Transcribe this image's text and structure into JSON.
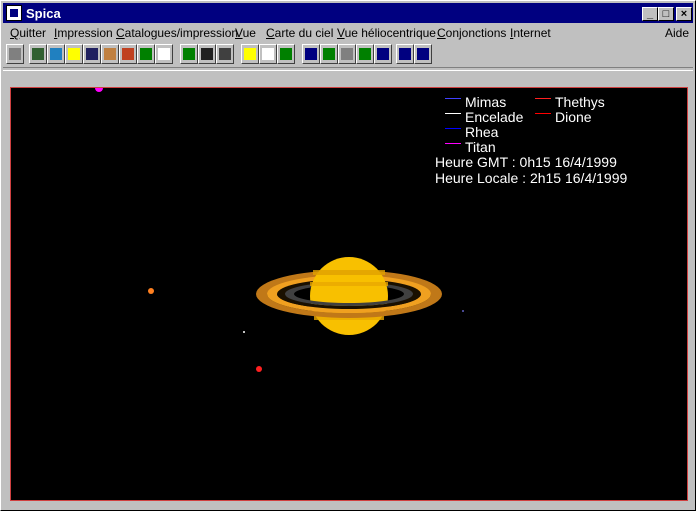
{
  "window": {
    "title": "Spica"
  },
  "menu": [
    {
      "label": "Quitter",
      "u": "Q",
      "rest": "uitter"
    },
    {
      "label": "Impression",
      "u": "I",
      "rest": "mpression"
    },
    {
      "label": "Catalogues/impression",
      "u": "C",
      "rest": "atalogues/impression"
    },
    {
      "label": "Vue",
      "u": "V",
      "rest": "ue"
    },
    {
      "label": "Carte du ciel",
      "u": "C",
      "rest": "arte du ciel"
    },
    {
      "label": "Vue héliocentrique",
      "u": "V",
      "rest": "ue héliocentrique"
    },
    {
      "label": "Conjonctions",
      "u": "C",
      "rest": "onjonctions"
    },
    {
      "label": "Internet",
      "u": "I",
      "rest": "nternet"
    }
  ],
  "help_menu": "Aide",
  "toolbar_icons": [
    "print-icon",
    "globe-icon",
    "landscape-icon",
    "star-icon",
    "night-sky-icon",
    "saturn-icon",
    "planet-icon",
    "chart-icon",
    "list-icon",
    "globe-green-icon",
    "starfield-icon",
    "curve-icon",
    "sun-icon",
    "camera-icon",
    "tree-icon",
    "first-icon",
    "prev-icon",
    "stop-icon",
    "next-icon",
    "last-icon",
    "rewind-icon",
    "fast-forward-icon"
  ],
  "legend": {
    "left": [
      {
        "name": "Mimas",
        "color": "#4040ff"
      },
      {
        "name": "Encelade",
        "color": "#ffffff"
      },
      {
        "name": "Rhea",
        "color": "#0000ff"
      },
      {
        "name": "Titan",
        "color": "#ff00ff"
      }
    ],
    "right": [
      {
        "name": "Thethys",
        "color": "#ff2020"
      },
      {
        "name": "Dione",
        "color": "#ff0000"
      }
    ]
  },
  "time": {
    "gmt": "Heure GMT : 0h15 16/4/1999",
    "local": "Heure Locale : 2h15 16/4/1999"
  }
}
